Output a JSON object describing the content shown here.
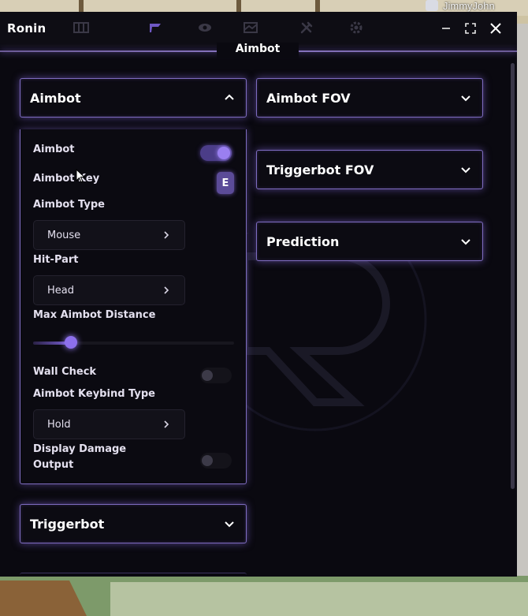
{
  "player": {
    "name": "JimmyJohn"
  },
  "window": {
    "title": "Ronin",
    "page_title": "Aimbot",
    "tabs": [
      {
        "icon": "grid-icon",
        "active": false
      },
      {
        "icon": "flag-icon",
        "active": true
      },
      {
        "icon": "eye-icon",
        "active": false
      },
      {
        "icon": "world-icon",
        "active": false
      },
      {
        "icon": "tools-icon",
        "active": false
      },
      {
        "icon": "gear-icon",
        "active": false
      }
    ],
    "controls": [
      "minimize-icon",
      "maximize-icon",
      "close-icon"
    ]
  },
  "sections": {
    "aimbot": {
      "title": "Aimbot",
      "expanded": true,
      "options": {
        "aimbot": {
          "label": "Aimbot",
          "enabled": true
        },
        "aimbot_key": {
          "label": "Aimbot Key",
          "value": "E"
        },
        "aimbot_type": {
          "label": "Aimbot Type",
          "value": "Mouse"
        },
        "hit_part": {
          "label": "Hit-Part",
          "value": "Head"
        },
        "max_distance": {
          "label": "Max Aimbot Distance",
          "fraction": 0.19
        },
        "wall_check": {
          "label": "Wall Check",
          "enabled": false
        },
        "keybind_type": {
          "label": "Aimbot Keybind Type",
          "value": "Hold"
        },
        "display_damage": {
          "label": "Display Damage Output",
          "label_line1": "Display Damage",
          "label_line2": "Output",
          "enabled": false
        }
      }
    },
    "aimbot_fov": {
      "title": "Aimbot FOV",
      "expanded": false
    },
    "triggerbot_fov": {
      "title": "Triggerbot FOV",
      "expanded": false
    },
    "prediction": {
      "title": "Prediction",
      "expanded": false
    },
    "triggerbot": {
      "title": "Triggerbot",
      "expanded": false
    }
  },
  "colors": {
    "accent": "#8d70ec",
    "border": "#7e6cc0",
    "panel": "#0b0a11"
  }
}
